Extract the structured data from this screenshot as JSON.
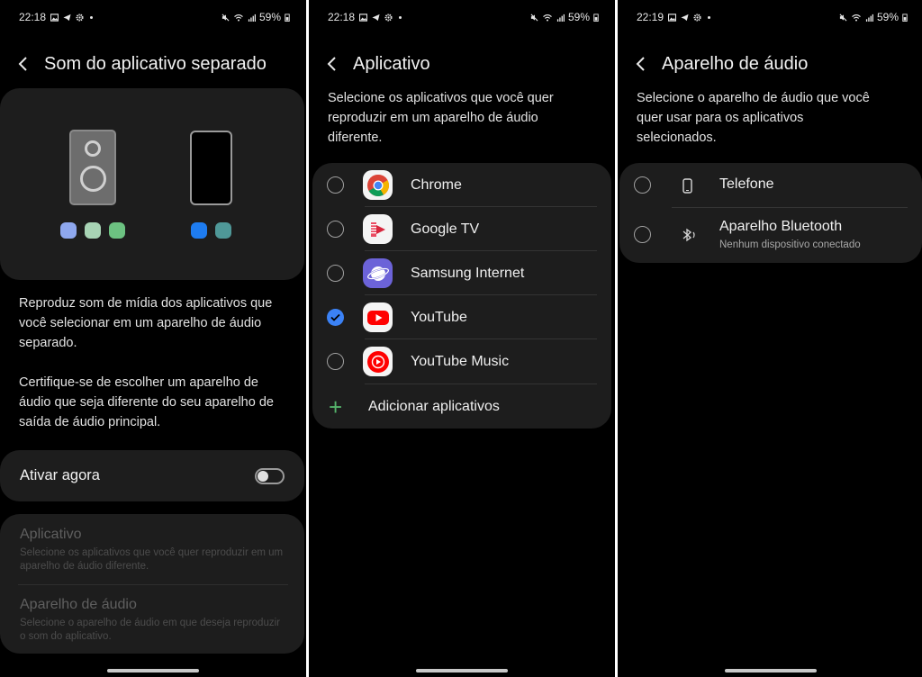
{
  "status_bars": [
    {
      "time": "22:18",
      "battery": "59%"
    },
    {
      "time": "22:18",
      "battery": "59%"
    },
    {
      "time": "22:19",
      "battery": "59%"
    }
  ],
  "screen1": {
    "title": "Som do aplicativo separado",
    "description_1": "Reproduz som de mídia dos aplicativos que você selecionar em um aparelho de áudio separado.",
    "description_2": "Certifique-se de escolher um aparelho de áudio que seja diferente do seu aparelho de saída de áudio principal.",
    "toggle_label": "Ativar agora",
    "toggle_on": false,
    "settings": [
      {
        "title": "Aplicativo",
        "subtitle": "Selecione os aplicativos que você quer reproduzir em um aparelho de áudio diferente."
      },
      {
        "title": "Aparelho de áudio",
        "subtitle": "Selecione o aparelho de áudio em que deseja reproduzir o som do aplicativo."
      }
    ],
    "colors": {
      "dot_purple": "#8ea7ee",
      "dot_mint": "#a8d4b5",
      "dot_green": "#6cc281",
      "dot_blue": "#1e7cf0",
      "dot_teal": "#4f9898"
    }
  },
  "screen2": {
    "title": "Aplicativo",
    "description": "Selecione os aplicativos que você quer reproduzir em um aparelho de áudio diferente.",
    "apps": [
      {
        "name": "Chrome",
        "icon": "chrome-icon",
        "checked": false
      },
      {
        "name": "Google TV",
        "icon": "google-tv-icon",
        "checked": false
      },
      {
        "name": "Samsung Internet",
        "icon": "samsung-internet-icon",
        "checked": false
      },
      {
        "name": "YouTube",
        "icon": "youtube-icon",
        "checked": true
      },
      {
        "name": "YouTube Music",
        "icon": "youtube-music-icon",
        "checked": false
      }
    ],
    "add_label": "Adicionar aplicativos",
    "accent": "#3b82f6"
  },
  "screen3": {
    "title": "Aparelho de áudio",
    "description": "Selecione o aparelho de áudio que você quer usar para os aplicativos selecionados.",
    "devices": [
      {
        "name": "Telefone",
        "icon": "phone-icon",
        "subtitle": ""
      },
      {
        "name": "Aparelho Bluetooth",
        "icon": "bluetooth-icon",
        "subtitle": "Nenhum dispositivo conectado"
      }
    ]
  }
}
